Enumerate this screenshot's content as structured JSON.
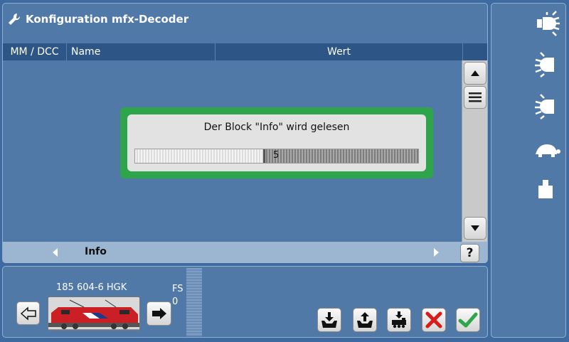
{
  "window": {
    "title": "Konfiguration mfx-Decoder"
  },
  "table": {
    "columns": [
      "MM / DCC",
      "Name",
      "Wert"
    ]
  },
  "dialog": {
    "message": "Der Block \"Info\" wird gelesen",
    "progress_label": "5",
    "progress_fraction": 0.46
  },
  "nav": {
    "label": "Info",
    "help": "?"
  },
  "loco": {
    "name": "185 604-6 HGK",
    "fs_label": "FS",
    "fs_value": "0"
  },
  "side_icons": [
    "headlight-icon",
    "light-left-icon",
    "light-left-2-icon",
    "turtle-icon",
    "weight-icon"
  ],
  "action_buttons": [
    "import-icon",
    "export-icon",
    "load-to-loco-icon",
    "cancel-icon",
    "confirm-icon"
  ],
  "colors": {
    "dialog_border": "#2ea54a",
    "panel": "#5179a7",
    "header": "#2d5586",
    "cancel": "#d81b1b",
    "confirm": "#2ea54a"
  }
}
